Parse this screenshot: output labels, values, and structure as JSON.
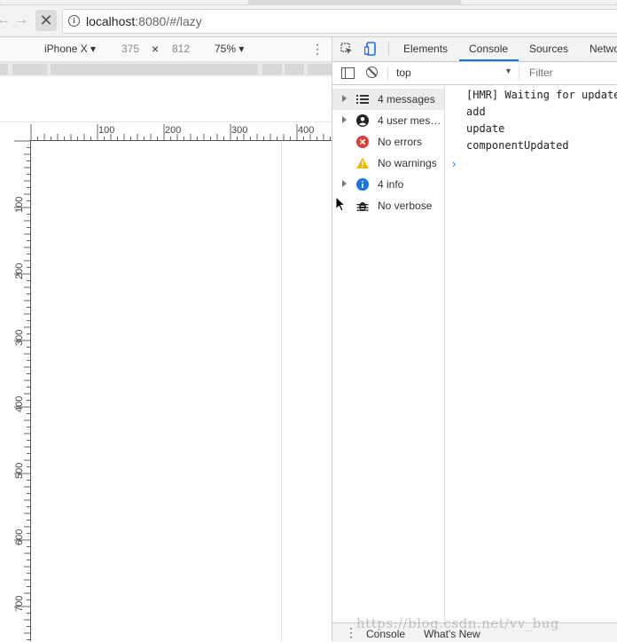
{
  "browser": {
    "url_host": "localhost",
    "url_rest": ":8080/#/lazy",
    "back_glyph": "←",
    "forward_glyph": "→",
    "stop_glyph": "✕",
    "info_glyph": "i"
  },
  "device_toolbar": {
    "device": "iPhone X ▾",
    "width": "375",
    "times": "×",
    "height": "812",
    "zoom": "75% ▾",
    "more_glyph": "⋮"
  },
  "rulers": {
    "horizontal": [
      "100",
      "200",
      "300",
      "400"
    ],
    "vertical": [
      "100",
      "200",
      "300",
      "400",
      "500",
      "600",
      "700"
    ]
  },
  "devtools": {
    "tabs": [
      "Elements",
      "Console",
      "Sources",
      "Network"
    ],
    "active_tab": "Console",
    "context": "top",
    "context_arrow": "▼",
    "filter_placeholder": "Filter",
    "sidebar": [
      {
        "label": "4 messages",
        "icon": "list-icon",
        "expandable": true,
        "selected": true
      },
      {
        "label": "4 user mes…",
        "icon": "user-icon",
        "expandable": true,
        "selected": false
      },
      {
        "label": "No errors",
        "icon": "error-icon",
        "expandable": false,
        "selected": false
      },
      {
        "label": "No warnings",
        "icon": "warning-icon",
        "expandable": false,
        "selected": false
      },
      {
        "label": "4 info",
        "icon": "info-icon",
        "expandable": true,
        "selected": false
      },
      {
        "label": "No verbose",
        "icon": "bug-icon",
        "expandable": false,
        "selected": false
      }
    ],
    "console_lines": [
      "[HMR] Waiting for update signal from WDS...",
      "add",
      "update",
      "componentUpdated"
    ],
    "prompt_glyph": "›",
    "drawer_tabs": [
      "Console",
      "What's New"
    ],
    "drawer_more_glyph": "⋮"
  },
  "watermark": "https://blog.csdn.net/vv_bug",
  "colors": {
    "accent": "#1a73e8",
    "error": "#e53935",
    "warning": "#f4b400",
    "info": "#1a73e8"
  }
}
